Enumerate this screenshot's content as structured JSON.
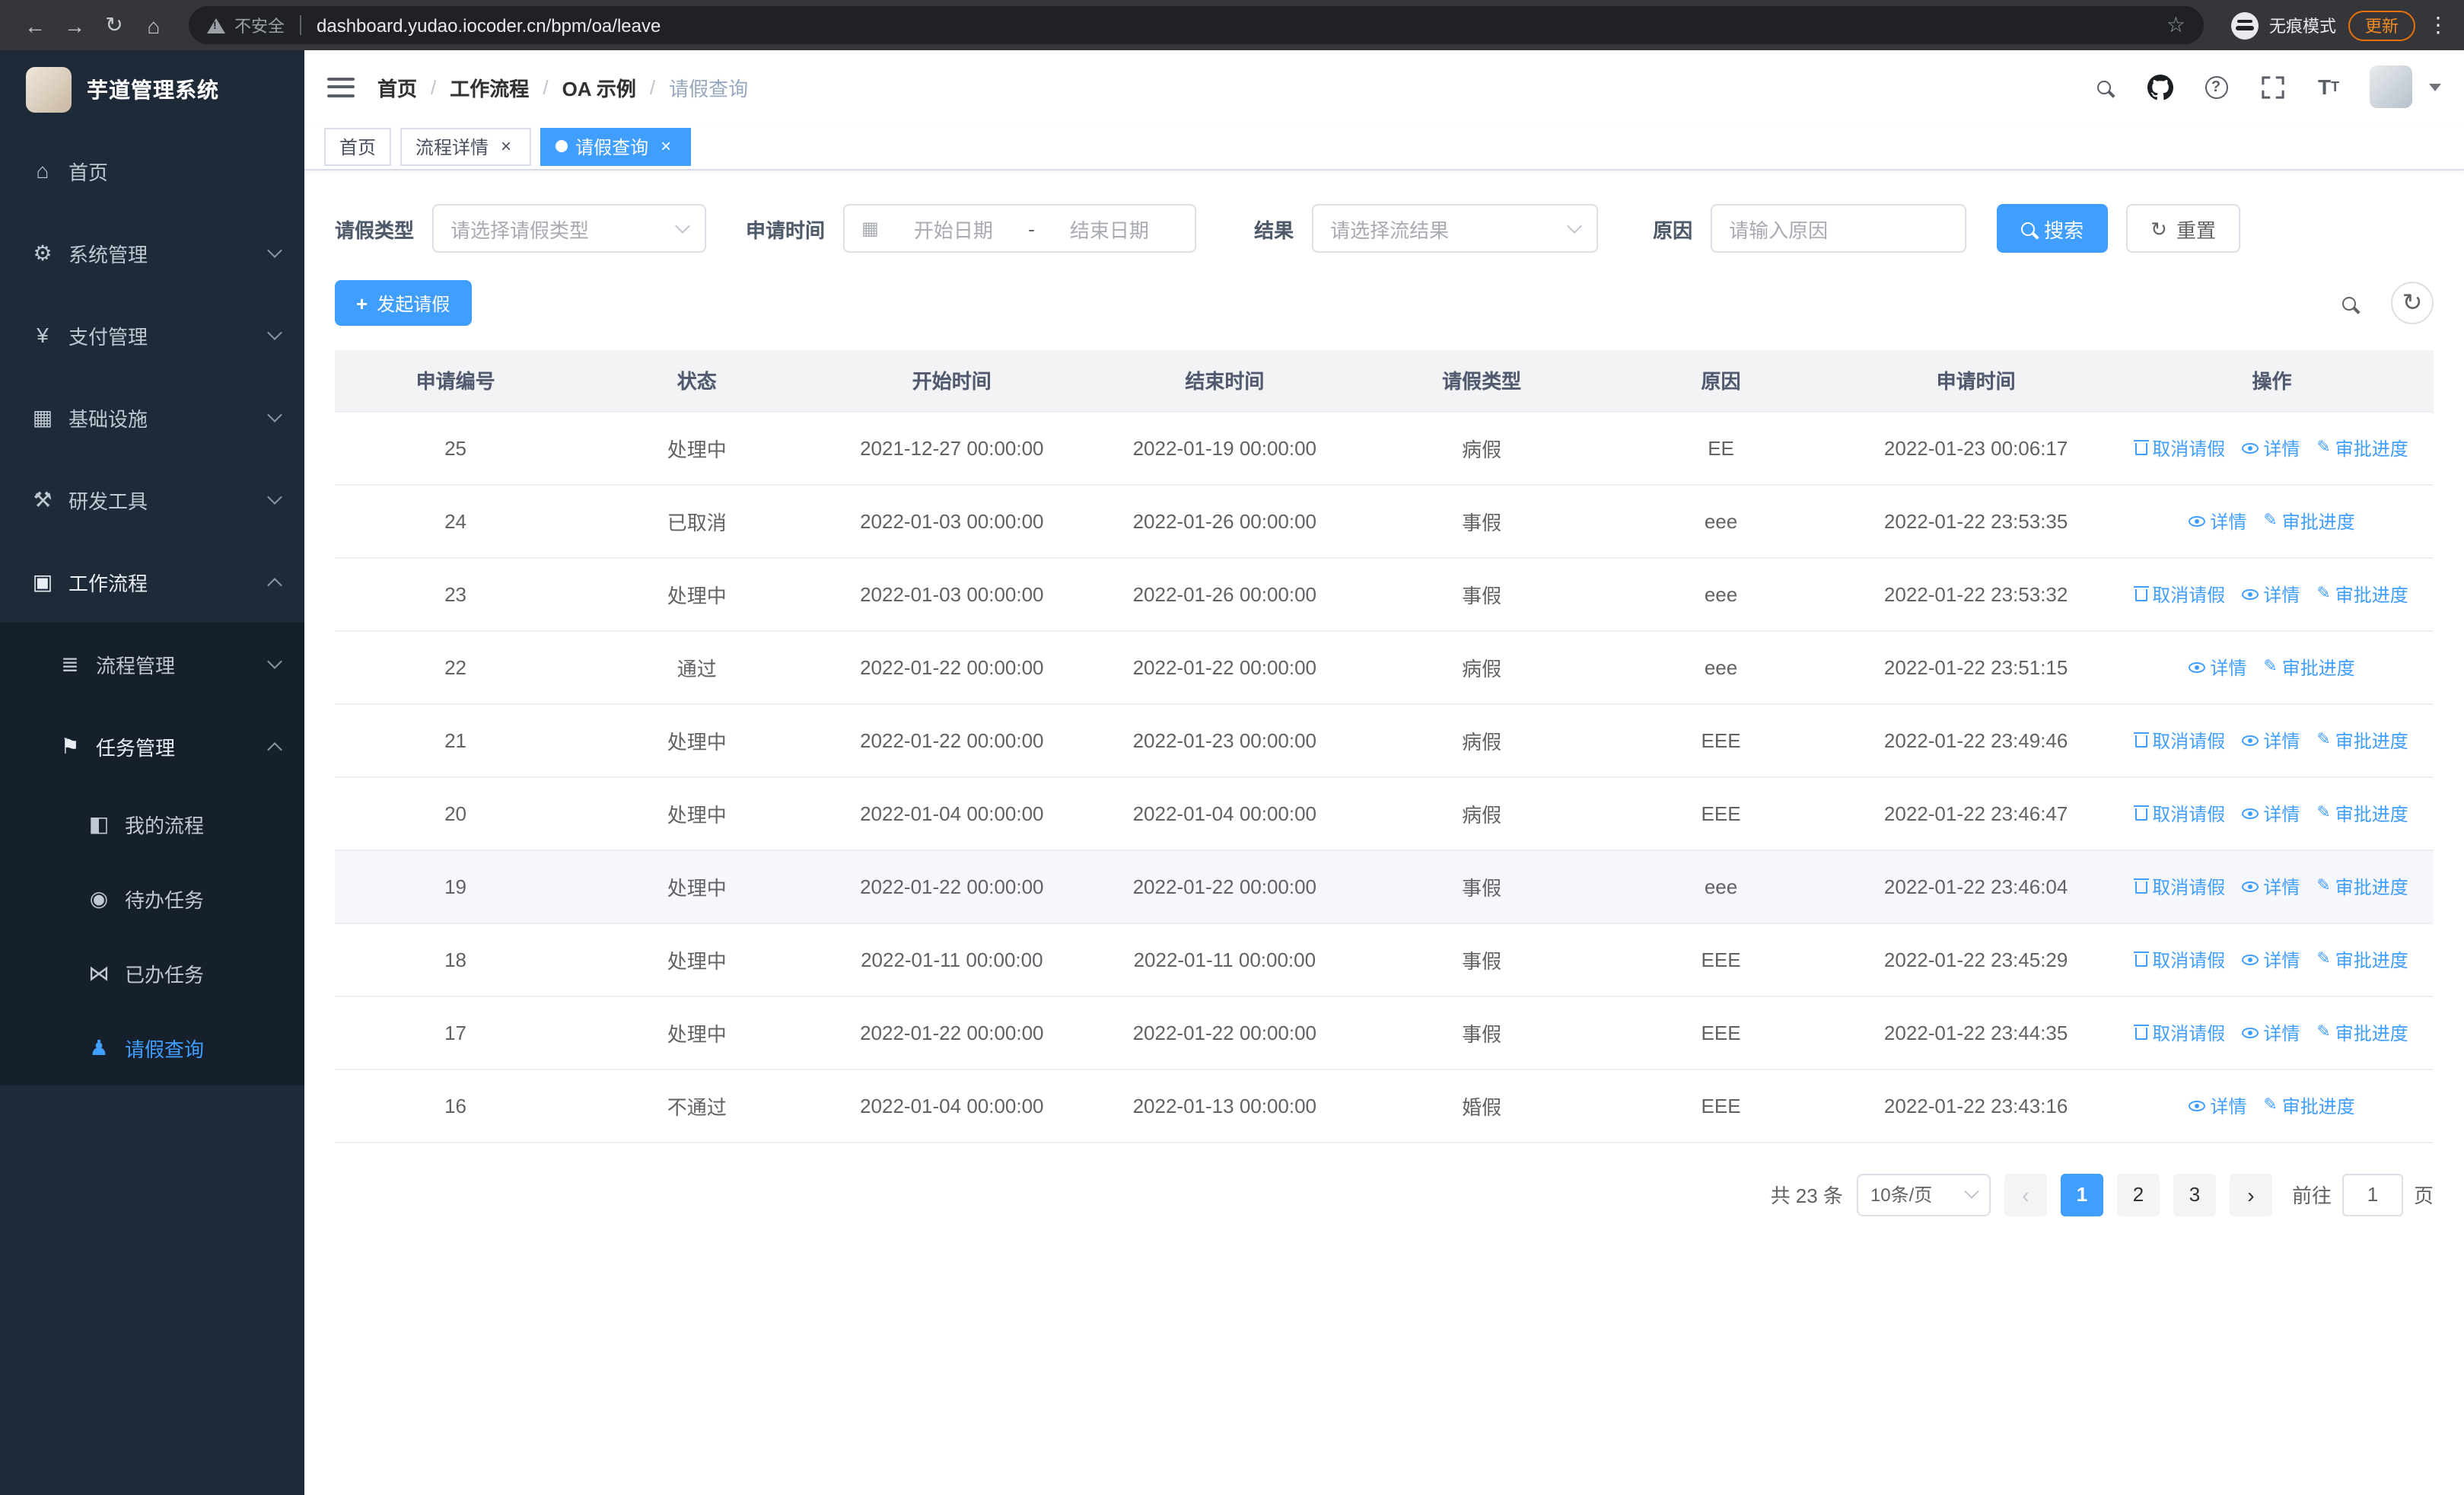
{
  "colors": {
    "primary": "#409eff",
    "sidebar_bg": "#1e2a38",
    "submenu_bg": "#16202c",
    "chrome_bg": "#35363a",
    "urlbar_bg": "#202124",
    "update_accent": "#f28b24",
    "row_highlight": "#f5f7fa"
  },
  "browser": {
    "security_text": "不安全",
    "url": "dashboard.yudao.iocoder.cn/bpm/oa/leave",
    "incognito_text": "无痕模式",
    "update_text": "更新"
  },
  "icons": {
    "home-icon": "⌂",
    "gear-icon": "⚙",
    "payment-icon": "¥",
    "infrastructure-icon": "▦",
    "devtools-icon": "⚒",
    "workflow-icon": "▣",
    "process-icon": "≣",
    "task-icon": "⚑",
    "my-process-icon": "◧",
    "todo-icon": "◉",
    "done-icon": "⋈",
    "leave-icon": "♟",
    "back-icon": "←",
    "forward-icon": "→",
    "reload-icon": "↻",
    "home-btn-icon": "⌂",
    "star-icon": "☆",
    "more-icon": "⋮",
    "refresh-icon": "↻",
    "calendar-icon": "▦",
    "plus-icon": "+",
    "edit-icon": "✎",
    "prev-icon": "‹",
    "next-icon": "›"
  },
  "sidebar": {
    "logo_title": "芋道管理系统",
    "items": [
      {
        "key": "home",
        "label": "首页",
        "icon": "home-icon",
        "level": 1
      },
      {
        "key": "system-management",
        "label": "系统管理",
        "icon": "gear-icon",
        "level": 1,
        "chevron": "down"
      },
      {
        "key": "payment-management",
        "label": "支付管理",
        "icon": "payment-icon",
        "level": 1,
        "chevron": "down"
      },
      {
        "key": "infrastructure",
        "label": "基础设施",
        "icon": "infrastructure-icon",
        "level": 1,
        "chevron": "down"
      },
      {
        "key": "devtools",
        "label": "研发工具",
        "icon": "devtools-icon",
        "level": 1,
        "chevron": "down"
      },
      {
        "key": "workflow",
        "label": "工作流程",
        "icon": "workflow-icon",
        "level": 1,
        "chevron": "up",
        "open": true
      },
      {
        "key": "process-management",
        "label": "流程管理",
        "icon": "process-icon",
        "level": 2,
        "chevron": "down",
        "submenu": true
      },
      {
        "key": "task-management",
        "label": "任务管理",
        "icon": "task-icon",
        "level": 2,
        "chevron": "up",
        "submenu": true,
        "open": true
      },
      {
        "key": "my-process",
        "label": "我的流程",
        "icon": "my-process-icon",
        "level": 3,
        "submenu": true
      },
      {
        "key": "todo-tasks",
        "label": "待办任务",
        "icon": "todo-icon",
        "level": 3,
        "submenu": true
      },
      {
        "key": "done-tasks",
        "label": "已办任务",
        "icon": "done-icon",
        "level": 3,
        "submenu": true
      },
      {
        "key": "leave-query",
        "label": "请假查询",
        "icon": "leave-icon",
        "level": 3,
        "submenu": true,
        "active": true
      }
    ]
  },
  "navbar": {
    "breadcrumb": [
      "首页",
      "工作流程",
      "OA 示例",
      "请假查询"
    ]
  },
  "tabs": [
    {
      "label": "首页",
      "closable": false,
      "active": false
    },
    {
      "label": "流程详情",
      "closable": true,
      "active": false
    },
    {
      "label": "请假查询",
      "closable": true,
      "active": true
    }
  ],
  "filters": {
    "leave_type_label": "请假类型",
    "leave_type_placeholder": "请选择请假类型",
    "time_label": "申请时间",
    "start_date_placeholder": "开始日期",
    "range_separator": "-",
    "end_date_placeholder": "结束日期",
    "result_label": "结果",
    "result_placeholder": "请选择流结果",
    "reason_label": "原因",
    "reason_placeholder": "请输入原因",
    "search_label": "搜索",
    "reset_label": "重置"
  },
  "toolbar": {
    "create_label": "发起请假"
  },
  "table": {
    "columns": [
      "申请编号",
      "状态",
      "开始时间",
      "结束时间",
      "请假类型",
      "原因",
      "申请时间",
      "操作"
    ],
    "actions": {
      "cancel": "取消请假",
      "detail": "详情",
      "progress": "审批进度"
    },
    "rows": [
      {
        "id": "25",
        "status": "处理中",
        "start": "2021-12-27 00:00:00",
        "end": "2022-01-19 00:00:00",
        "type": "病假",
        "reason": "EE",
        "applied": "2022-01-23 00:06:17",
        "can_cancel": true
      },
      {
        "id": "24",
        "status": "已取消",
        "start": "2022-01-03 00:00:00",
        "end": "2022-01-26 00:00:00",
        "type": "事假",
        "reason": "eee",
        "applied": "2022-01-22 23:53:35",
        "can_cancel": false
      },
      {
        "id": "23",
        "status": "处理中",
        "start": "2022-01-03 00:00:00",
        "end": "2022-01-26 00:00:00",
        "type": "事假",
        "reason": "eee",
        "applied": "2022-01-22 23:53:32",
        "can_cancel": true
      },
      {
        "id": "22",
        "status": "通过",
        "start": "2022-01-22 00:00:00",
        "end": "2022-01-22 00:00:00",
        "type": "病假",
        "reason": "eee",
        "applied": "2022-01-22 23:51:15",
        "can_cancel": false
      },
      {
        "id": "21",
        "status": "处理中",
        "start": "2022-01-22 00:00:00",
        "end": "2022-01-23 00:00:00",
        "type": "病假",
        "reason": "EEE",
        "applied": "2022-01-22 23:49:46",
        "can_cancel": true
      },
      {
        "id": "20",
        "status": "处理中",
        "start": "2022-01-04 00:00:00",
        "end": "2022-01-04 00:00:00",
        "type": "病假",
        "reason": "EEE",
        "applied": "2022-01-22 23:46:47",
        "can_cancel": true
      },
      {
        "id": "19",
        "status": "处理中",
        "start": "2022-01-22 00:00:00",
        "end": "2022-01-22 00:00:00",
        "type": "事假",
        "reason": "eee",
        "applied": "2022-01-22 23:46:04",
        "can_cancel": true,
        "highlight": true
      },
      {
        "id": "18",
        "status": "处理中",
        "start": "2022-01-11 00:00:00",
        "end": "2022-01-11 00:00:00",
        "type": "事假",
        "reason": "EEE",
        "applied": "2022-01-22 23:45:29",
        "can_cancel": true
      },
      {
        "id": "17",
        "status": "处理中",
        "start": "2022-01-22 00:00:00",
        "end": "2022-01-22 00:00:00",
        "type": "事假",
        "reason": "EEE",
        "applied": "2022-01-22 23:44:35",
        "can_cancel": true
      },
      {
        "id": "16",
        "status": "不通过",
        "start": "2022-01-04 00:00:00",
        "end": "2022-01-13 00:00:00",
        "type": "婚假",
        "reason": "EEE",
        "applied": "2022-01-22 23:43:16",
        "can_cancel": false
      }
    ]
  },
  "pagination": {
    "total_text": "共 23 条",
    "page_size": "10条/页",
    "pages": [
      "1",
      "2",
      "3"
    ],
    "active_page": "1",
    "goto_prefix": "前往",
    "goto_value": "1",
    "goto_suffix": "页"
  }
}
